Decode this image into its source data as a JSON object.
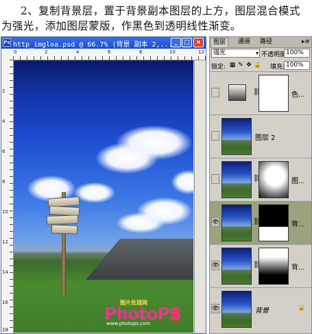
{
  "instruction": {
    "line1": "2、复制背景层，置于背景副本图层的上方，图层混合模式",
    "line2": "为强光，添加图层蒙版，作黑色到透明线性渐变。"
  },
  "document": {
    "title": "http_imgloa.psd @ 66.7% (背景 副本 2,...",
    "ruler_top": [
      "0",
      "2",
      "4",
      "6",
      "8",
      "10",
      "12"
    ],
    "ruler_left": [
      "2",
      "4",
      "6",
      "8",
      "10",
      "12",
      "14",
      "16",
      "18"
    ],
    "watermark_logo": "PhotoPS",
    "watermark_sub": "图片处理网",
    "watermark_url": "www.photops.com"
  },
  "layers_panel": {
    "tabs": [
      "图层",
      "通道",
      "路径"
    ],
    "blend_mode": "强光",
    "opacity_label": "不透明度:",
    "opacity_value": "100%",
    "lock_label": "锁定:",
    "fill_label": "填充:",
    "fill_value": "100%",
    "layers": [
      {
        "name": "色...",
        "visible": false,
        "selected": false
      },
      {
        "name": "图层 2",
        "visible": false,
        "selected": false
      },
      {
        "name": "图...",
        "visible": false,
        "selected": false
      },
      {
        "name": "背...",
        "visible": true,
        "selected": true
      },
      {
        "name": "背...",
        "visible": true,
        "selected": false
      },
      {
        "name": "背景",
        "visible": true,
        "selected": false
      }
    ]
  },
  "colors": {
    "titlebar": "#1b4fc9",
    "selected_layer": "#9aa27e",
    "close_button": "#d6442c"
  }
}
